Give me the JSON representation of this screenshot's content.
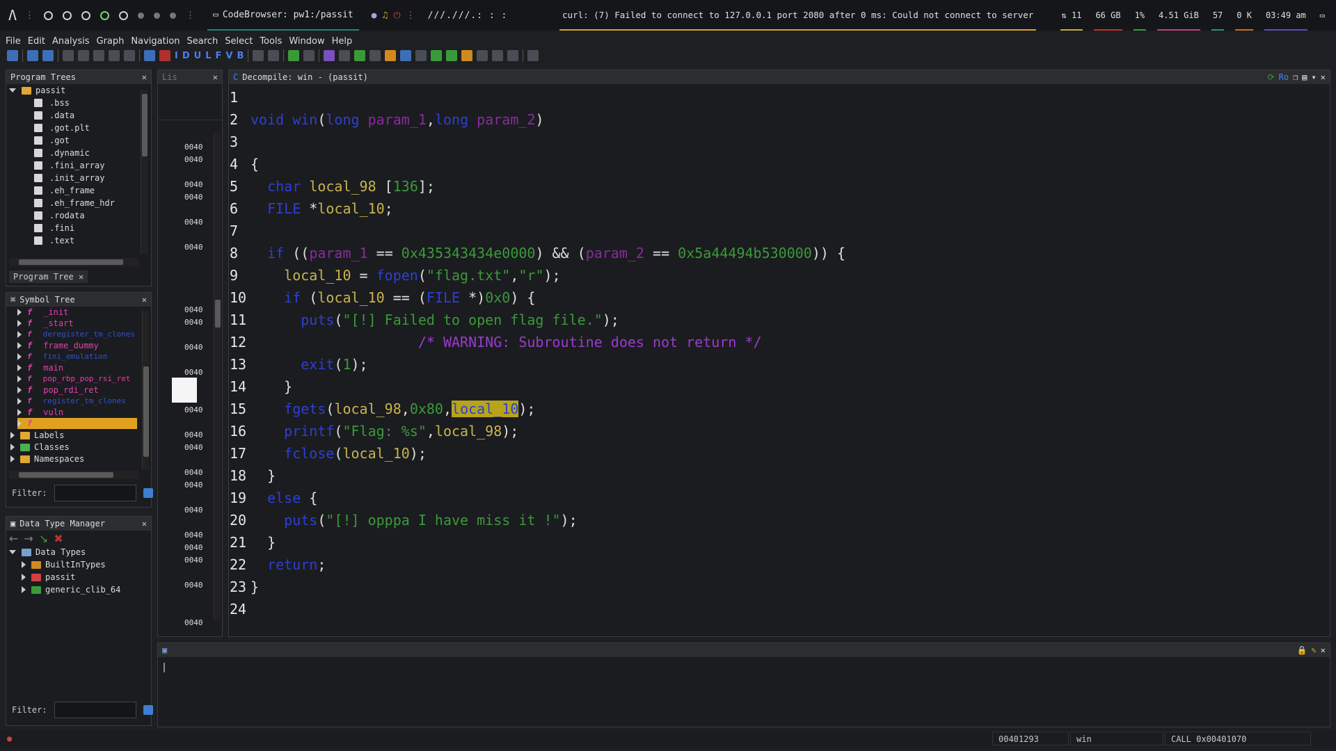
{
  "topbar": {
    "window_title": "CodeBrowser: pw1:/passit",
    "breadcrumb": "///.///.:  : :",
    "curl_message": "curl: (7) Failed to connect to 127.0.0.1 port 2080 after 0 ms: Could not connect to server",
    "stats": [
      "⇅ 11",
      "66 GB",
      "1%",
      "4.51 GiB",
      "57",
      "0 K",
      "03:49 am"
    ]
  },
  "menu": [
    "File",
    "Edit",
    "Analysis",
    "Graph",
    "Navigation",
    "Search",
    "Select",
    "Tools",
    "Window",
    "Help"
  ],
  "toolbar_letters": [
    "I",
    "D",
    "U",
    "L",
    "F",
    "V",
    "B"
  ],
  "program_trees": {
    "title": "Program Trees",
    "root": "passit",
    "items": [
      ".bss",
      ".data",
      ".got.plt",
      ".got",
      ".dynamic",
      ".fini_array",
      ".init_array",
      ".eh_frame",
      ".eh_frame_hdr",
      ".rodata",
      ".fini",
      ".text"
    ],
    "tab": "Program Tree"
  },
  "symbol_tree": {
    "title": "Symbol Tree",
    "functions": [
      {
        "name": "_init",
        "color": "pink"
      },
      {
        "name": "_start",
        "color": "pink"
      },
      {
        "name": "deregister_tm_clones",
        "color": "blue"
      },
      {
        "name": "frame_dummy",
        "color": "pink"
      },
      {
        "name": "fini_emulation",
        "color": "blue"
      },
      {
        "name": "main",
        "color": "pink"
      },
      {
        "name": "pop_rbp_pop_rsi_ret",
        "color": "pink"
      },
      {
        "name": "pop_rdi_ret",
        "color": "pink"
      },
      {
        "name": "register_tm_clones",
        "color": "blue"
      },
      {
        "name": "vuln",
        "color": "pink"
      },
      {
        "name": "",
        "color": "selected"
      }
    ],
    "folders": [
      "Labels",
      "Classes",
      "Namespaces"
    ],
    "filter_label": "Filter:"
  },
  "data_type_manager": {
    "title": "Data Type Manager",
    "root": "Data Types",
    "items": [
      "BuiltInTypes",
      "passit",
      "generic_clib_64"
    ],
    "filter_label": "Filter:"
  },
  "listing": {
    "tab": "Lis",
    "addresses": [
      "0040",
      "0040",
      "0040",
      "0040",
      "0040",
      "0040",
      "0040",
      "0040",
      "0040",
      "0040",
      "0040",
      "0040",
      "0040",
      "0040",
      "0040",
      "0040",
      "0040",
      "0040",
      "0040",
      "0040",
      "0040",
      "0040"
    ]
  },
  "decompile": {
    "title": "Decompile: win -  (passit)",
    "ro_label": "Ro",
    "lines": [
      {
        "n": "1",
        "tokens": []
      },
      {
        "n": "2",
        "tokens": [
          [
            "kw",
            "void"
          ],
          [
            "pl",
            " "
          ],
          [
            "fn",
            "win"
          ],
          [
            "pl",
            "("
          ],
          [
            "ty",
            "long"
          ],
          [
            "pl",
            " "
          ],
          [
            "pr",
            "param_1"
          ],
          [
            "pl",
            ","
          ],
          [
            "ty",
            "long"
          ],
          [
            "pl",
            " "
          ],
          [
            "pr",
            "param_2"
          ],
          [
            "pl",
            ")"
          ]
        ]
      },
      {
        "n": "3",
        "tokens": []
      },
      {
        "n": "4",
        "tokens": [
          [
            "pl",
            "{"
          ]
        ]
      },
      {
        "n": "5",
        "tokens": [
          [
            "pl",
            "  "
          ],
          [
            "ty",
            "char"
          ],
          [
            "pl",
            " "
          ],
          [
            "lv",
            "local_98"
          ],
          [
            "pl",
            " ["
          ],
          [
            "nm",
            "136"
          ],
          [
            "pl",
            "];"
          ]
        ]
      },
      {
        "n": "6",
        "tokens": [
          [
            "pl",
            "  "
          ],
          [
            "ty",
            "FILE"
          ],
          [
            "pl",
            " *"
          ],
          [
            "lv",
            "local_10"
          ],
          [
            "pl",
            ";"
          ]
        ]
      },
      {
        "n": "7",
        "tokens": []
      },
      {
        "n": "8",
        "tokens": [
          [
            "pl",
            "  "
          ],
          [
            "kw",
            "if"
          ],
          [
            "pl",
            " (("
          ],
          [
            "pr",
            "param_1"
          ],
          [
            "pl",
            " == "
          ],
          [
            "nm",
            "0x435343434e0000"
          ],
          [
            "pl",
            ") && ("
          ],
          [
            "pr",
            "param_2"
          ],
          [
            "pl",
            " == "
          ],
          [
            "nm",
            "0x5a44494b530000"
          ],
          [
            "pl",
            ")) {"
          ]
        ]
      },
      {
        "n": "9",
        "tokens": [
          [
            "pl",
            "    "
          ],
          [
            "lv",
            "local_10"
          ],
          [
            "pl",
            " = "
          ],
          [
            "fn",
            "fopen"
          ],
          [
            "pl",
            "("
          ],
          [
            "st",
            "\"flag.txt\""
          ],
          [
            "pl",
            ","
          ],
          [
            "st",
            "\"r\""
          ],
          [
            "pl",
            ");"
          ]
        ]
      },
      {
        "n": "10",
        "tokens": [
          [
            "pl",
            "    "
          ],
          [
            "kw",
            "if"
          ],
          [
            "pl",
            " ("
          ],
          [
            "lv",
            "local_10"
          ],
          [
            "pl",
            " == ("
          ],
          [
            "ty",
            "FILE"
          ],
          [
            "pl",
            " *)"
          ],
          [
            "nm",
            "0x0"
          ],
          [
            "pl",
            ") {"
          ]
        ]
      },
      {
        "n": "11",
        "tokens": [
          [
            "pl",
            "      "
          ],
          [
            "fn",
            "puts"
          ],
          [
            "pl",
            "("
          ],
          [
            "st",
            "\"[!] Failed to open flag file.\""
          ],
          [
            "pl",
            ");"
          ]
        ]
      },
      {
        "n": "12",
        "tokens": [
          [
            "pl",
            "                    "
          ],
          [
            "cm",
            "/* WARNING: Subroutine does not return */"
          ]
        ]
      },
      {
        "n": "13",
        "tokens": [
          [
            "pl",
            "      "
          ],
          [
            "fn",
            "exit"
          ],
          [
            "pl",
            "("
          ],
          [
            "nm",
            "1"
          ],
          [
            "pl",
            ");"
          ]
        ]
      },
      {
        "n": "14",
        "tokens": [
          [
            "pl",
            "    }"
          ]
        ]
      },
      {
        "n": "15",
        "tokens": [
          [
            "pl",
            "    "
          ],
          [
            "fn",
            "fgets"
          ],
          [
            "pl",
            "("
          ],
          [
            "lv",
            "local_98"
          ],
          [
            "pl",
            ","
          ],
          [
            "nm",
            "0x80"
          ],
          [
            "pl",
            ","
          ],
          [
            "hl",
            "local_10"
          ],
          [
            "pl",
            ");"
          ]
        ]
      },
      {
        "n": "16",
        "tokens": [
          [
            "pl",
            "    "
          ],
          [
            "fn",
            "printf"
          ],
          [
            "pl",
            "("
          ],
          [
            "st",
            "\"Flag: %s\""
          ],
          [
            "pl",
            ","
          ],
          [
            "lv",
            "local_98"
          ],
          [
            "pl",
            ");"
          ]
        ]
      },
      {
        "n": "17",
        "tokens": [
          [
            "pl",
            "    "
          ],
          [
            "fn",
            "fclose"
          ],
          [
            "pl",
            "("
          ],
          [
            "lv",
            "local_10"
          ],
          [
            "pl",
            ");"
          ]
        ]
      },
      {
        "n": "18",
        "tokens": [
          [
            "pl",
            "  }"
          ]
        ]
      },
      {
        "n": "19",
        "tokens": [
          [
            "pl",
            "  "
          ],
          [
            "kw",
            "else"
          ],
          [
            "pl",
            " {"
          ]
        ]
      },
      {
        "n": "20",
        "tokens": [
          [
            "pl",
            "    "
          ],
          [
            "fn",
            "puts"
          ],
          [
            "pl",
            "("
          ],
          [
            "st",
            "\"[!] opppa I have miss it !\""
          ],
          [
            "pl",
            ");"
          ]
        ]
      },
      {
        "n": "21",
        "tokens": [
          [
            "pl",
            "  }"
          ]
        ]
      },
      {
        "n": "22",
        "tokens": [
          [
            "pl",
            "  "
          ],
          [
            "kw",
            "return"
          ],
          [
            "pl",
            ";"
          ]
        ]
      },
      {
        "n": "23",
        "tokens": [
          [
            "pl",
            "}"
          ]
        ]
      },
      {
        "n": "24",
        "tokens": []
      }
    ]
  },
  "statusbar": {
    "address": "00401293",
    "function": "win",
    "instruction": "CALL 0x00401070"
  }
}
